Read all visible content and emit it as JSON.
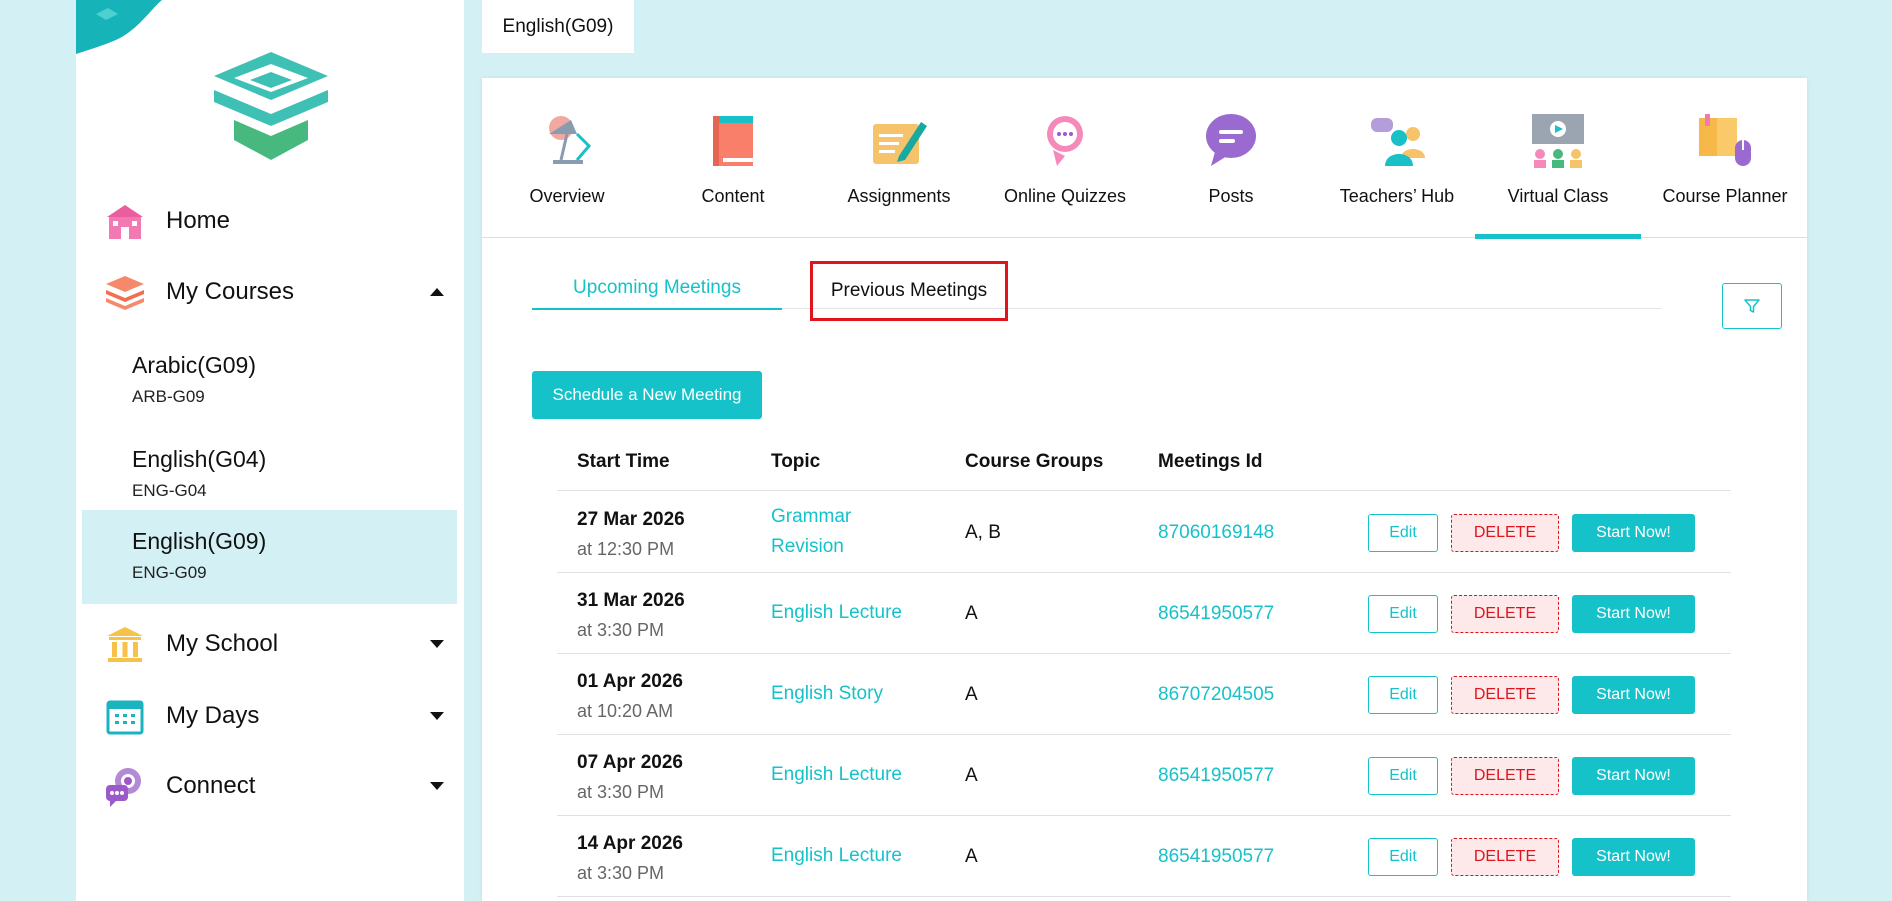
{
  "sidebar": {
    "nav": {
      "home": "Home",
      "my_courses": "My Courses",
      "my_school": "My School",
      "my_days": "My Days",
      "connect": "Connect"
    },
    "courses": [
      {
        "name": "Arabic(G09)",
        "code": "ARB-G09"
      },
      {
        "name": "English(G04)",
        "code": "ENG-G04"
      },
      {
        "name": "English(G09)",
        "code": "ENG-G09"
      }
    ]
  },
  "course_tab": "English(G09)",
  "modules": [
    {
      "label": "Overview",
      "icon": "lamp-icon"
    },
    {
      "label": "Content",
      "icon": "book-icon"
    },
    {
      "label": "Assignments",
      "icon": "assignment-icon"
    },
    {
      "label": "Online Quizzes",
      "icon": "quiz-icon"
    },
    {
      "label": "Posts",
      "icon": "chat-icon"
    },
    {
      "label": "Teachers’ Hub",
      "icon": "teachers-icon"
    },
    {
      "label": "Virtual Class",
      "icon": "virtual-class-icon"
    },
    {
      "label": "Course Planner",
      "icon": "planner-icon"
    }
  ],
  "subtabs": {
    "upcoming": "Upcoming Meetings",
    "previous": "Previous Meetings"
  },
  "schedule_label": "Schedule a New Meeting",
  "table": {
    "headers": {
      "start": "Start Time",
      "topic": "Topic",
      "groups": "Course Groups",
      "id": "Meetings Id"
    },
    "rows": [
      {
        "date": "27 Mar 2026",
        "time": "at 12:30 PM",
        "topic": "Grammar Revision",
        "groups": "A, B",
        "id": "87060169148"
      },
      {
        "date": "31 Mar 2026",
        "time": "at 3:30 PM",
        "topic": "English Lecture",
        "groups": "A",
        "id": "86541950577"
      },
      {
        "date": "01 Apr 2026",
        "time": "at 10:20 AM",
        "topic": "English Story",
        "groups": "A",
        "id": "86707204505"
      },
      {
        "date": "07 Apr 2026",
        "time": "at 3:30 PM",
        "topic": "English Lecture",
        "groups": "A",
        "id": "86541950577"
      },
      {
        "date": "14 Apr 2026",
        "time": "at 3:30 PM",
        "topic": "English Lecture",
        "groups": "A",
        "id": "86541950577"
      }
    ],
    "edit_label": "Edit",
    "delete_label": "DELETE",
    "start_label": "Start Now!"
  },
  "colors": {
    "accent": "#16c2c9",
    "danger": "#e0141c",
    "page_bg": "#d3f1f4"
  }
}
